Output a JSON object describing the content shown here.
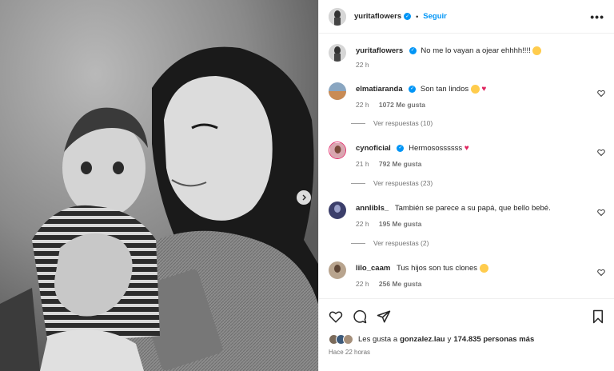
{
  "post": {
    "author": {
      "username": "yuritaflowers",
      "verified": true,
      "follow_label": "Seguir",
      "more_label": "•••"
    },
    "caption": {
      "username": "yuritaflowers",
      "text": "No me lo vayan a ojear ehhhh!!!!",
      "time": "22 h"
    },
    "comments": [
      {
        "username": "elmatiaranda",
        "verified": true,
        "text": "Son tan lindos",
        "emoji": "heart-eyes-and-red-heart",
        "time": "22 h",
        "likes": "1072 Me gusta",
        "replies": "Ver respuestas (10)"
      },
      {
        "username": "cynoficial",
        "verified": true,
        "text": "Hermosossssss",
        "emoji": "red-heart",
        "time": "21 h",
        "likes": "792 Me gusta",
        "replies": "Ver respuestas (23)"
      },
      {
        "username": "annlibls_",
        "verified": false,
        "text": "También se parece a su papá, que bello bebé.",
        "time": "22 h",
        "likes": "195 Me gusta",
        "replies": "Ver respuestas (2)"
      },
      {
        "username": "lilo_caam",
        "verified": false,
        "text": "Tus hijos son tus clones",
        "emoji": "heart-eyes",
        "time": "22 h",
        "likes": "256 Me gusta"
      }
    ],
    "likes_summary": {
      "prefix": "Les gusta a",
      "user": "gonzalez.lau",
      "connector": "y",
      "count": "174.835 personas más"
    },
    "posted_ago": "Hace 22 horas"
  },
  "icons": {
    "like": "heart-outline-icon",
    "comment": "comment-bubble-icon",
    "share": "paper-plane-icon",
    "save": "bookmark-icon",
    "next": "chevron-right-icon"
  },
  "colors": {
    "accent": "#0095f6",
    "text": "#262626",
    "muted": "#737373",
    "heart": "#e0245e"
  }
}
